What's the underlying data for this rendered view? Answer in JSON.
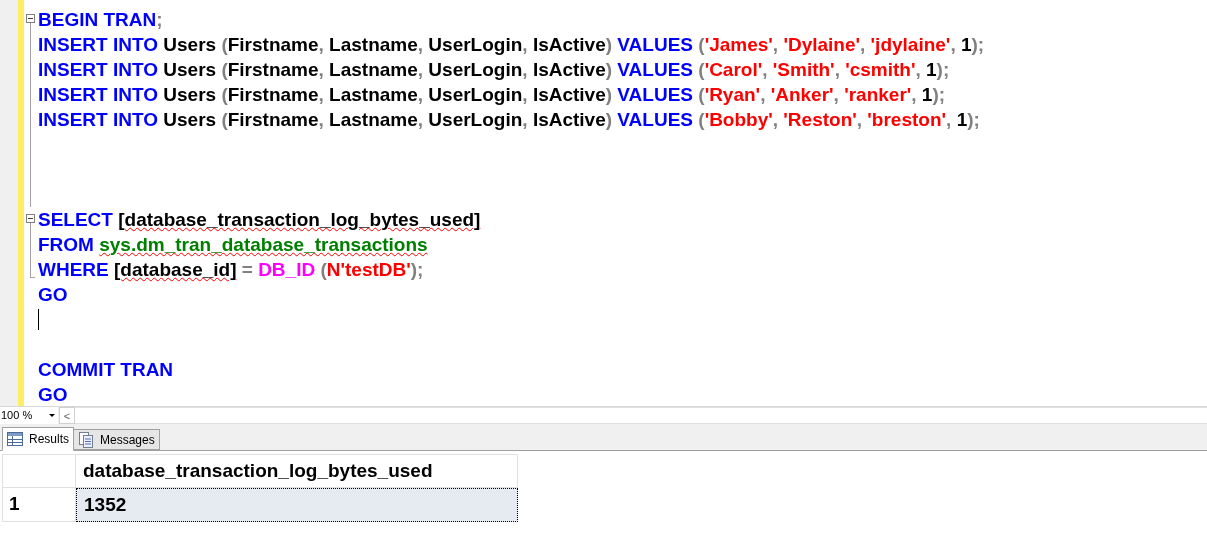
{
  "editor": {
    "lines": [
      {
        "kind": "fold_start",
        "tokens": [
          {
            "text": "BEGIN TRAN",
            "kind": "keyword"
          },
          {
            "text": ";",
            "kind": "punct"
          }
        ]
      },
      {
        "kind": "fold_body",
        "tokens": [
          {
            "text": "INSERT INTO ",
            "kind": "keyword"
          },
          {
            "text": "Users ",
            "kind": "ident"
          },
          {
            "text": "(",
            "kind": "punct"
          },
          {
            "text": "Firstname",
            "kind": "ident"
          },
          {
            "text": ", ",
            "kind": "punct"
          },
          {
            "text": "Lastname",
            "kind": "ident"
          },
          {
            "text": ", ",
            "kind": "punct"
          },
          {
            "text": "UserLogin",
            "kind": "ident"
          },
          {
            "text": ", ",
            "kind": "punct"
          },
          {
            "text": "IsActive",
            "kind": "ident"
          },
          {
            "text": ") ",
            "kind": "punct"
          },
          {
            "text": "VALUES ",
            "kind": "keyword"
          },
          {
            "text": "(",
            "kind": "punct"
          },
          {
            "text": "'James'",
            "kind": "string"
          },
          {
            "text": ", ",
            "kind": "punct"
          },
          {
            "text": "'Dylaine'",
            "kind": "string"
          },
          {
            "text": ", ",
            "kind": "punct"
          },
          {
            "text": "'jdylaine'",
            "kind": "string"
          },
          {
            "text": ", ",
            "kind": "punct"
          },
          {
            "text": "1",
            "kind": "number"
          },
          {
            "text": ");",
            "kind": "punct"
          }
        ]
      },
      {
        "kind": "fold_body",
        "tokens": [
          {
            "text": "INSERT INTO ",
            "kind": "keyword"
          },
          {
            "text": "Users ",
            "kind": "ident"
          },
          {
            "text": "(",
            "kind": "punct"
          },
          {
            "text": "Firstname",
            "kind": "ident"
          },
          {
            "text": ", ",
            "kind": "punct"
          },
          {
            "text": "Lastname",
            "kind": "ident"
          },
          {
            "text": ", ",
            "kind": "punct"
          },
          {
            "text": "UserLogin",
            "kind": "ident"
          },
          {
            "text": ", ",
            "kind": "punct"
          },
          {
            "text": "IsActive",
            "kind": "ident"
          },
          {
            "text": ") ",
            "kind": "punct"
          },
          {
            "text": "VALUES ",
            "kind": "keyword"
          },
          {
            "text": "(",
            "kind": "punct"
          },
          {
            "text": "'Carol'",
            "kind": "string"
          },
          {
            "text": ", ",
            "kind": "punct"
          },
          {
            "text": "'Smith'",
            "kind": "string"
          },
          {
            "text": ", ",
            "kind": "punct"
          },
          {
            "text": "'csmith'",
            "kind": "string"
          },
          {
            "text": ", ",
            "kind": "punct"
          },
          {
            "text": "1",
            "kind": "number"
          },
          {
            "text": ");",
            "kind": "punct"
          }
        ]
      },
      {
        "kind": "fold_body",
        "tokens": [
          {
            "text": "INSERT INTO ",
            "kind": "keyword"
          },
          {
            "text": "Users ",
            "kind": "ident"
          },
          {
            "text": "(",
            "kind": "punct"
          },
          {
            "text": "Firstname",
            "kind": "ident"
          },
          {
            "text": ", ",
            "kind": "punct"
          },
          {
            "text": "Lastname",
            "kind": "ident"
          },
          {
            "text": ", ",
            "kind": "punct"
          },
          {
            "text": "UserLogin",
            "kind": "ident"
          },
          {
            "text": ", ",
            "kind": "punct"
          },
          {
            "text": "IsActive",
            "kind": "ident"
          },
          {
            "text": ") ",
            "kind": "punct"
          },
          {
            "text": "VALUES ",
            "kind": "keyword"
          },
          {
            "text": "(",
            "kind": "punct"
          },
          {
            "text": "'Ryan'",
            "kind": "string"
          },
          {
            "text": ", ",
            "kind": "punct"
          },
          {
            "text": "'Anker'",
            "kind": "string"
          },
          {
            "text": ", ",
            "kind": "punct"
          },
          {
            "text": "'ranker'",
            "kind": "string"
          },
          {
            "text": ", ",
            "kind": "punct"
          },
          {
            "text": "1",
            "kind": "number"
          },
          {
            "text": ");",
            "kind": "punct"
          }
        ]
      },
      {
        "kind": "fold_body",
        "tokens": [
          {
            "text": "INSERT INTO ",
            "kind": "keyword"
          },
          {
            "text": "Users ",
            "kind": "ident"
          },
          {
            "text": "(",
            "kind": "punct"
          },
          {
            "text": "Firstname",
            "kind": "ident"
          },
          {
            "text": ", ",
            "kind": "punct"
          },
          {
            "text": "Lastname",
            "kind": "ident"
          },
          {
            "text": ", ",
            "kind": "punct"
          },
          {
            "text": "UserLogin",
            "kind": "ident"
          },
          {
            "text": ", ",
            "kind": "punct"
          },
          {
            "text": "IsActive",
            "kind": "ident"
          },
          {
            "text": ") ",
            "kind": "punct"
          },
          {
            "text": "VALUES ",
            "kind": "keyword"
          },
          {
            "text": "(",
            "kind": "punct"
          },
          {
            "text": "'Bobby'",
            "kind": "string"
          },
          {
            "text": ", ",
            "kind": "punct"
          },
          {
            "text": "'Reston'",
            "kind": "string"
          },
          {
            "text": ", ",
            "kind": "punct"
          },
          {
            "text": "'breston'",
            "kind": "string"
          },
          {
            "text": ", ",
            "kind": "punct"
          },
          {
            "text": "1",
            "kind": "number"
          },
          {
            "text": ");",
            "kind": "punct"
          }
        ]
      },
      {
        "kind": "fold_body"
      },
      {
        "kind": "fold_body"
      },
      {
        "kind": "fold_body"
      },
      {
        "kind": "fold_start",
        "tokens": [
          {
            "text": "SELECT ",
            "kind": "keyword"
          },
          {
            "text": "[database_transaction_log_bytes_used]",
            "kind": "flagged_ident"
          }
        ]
      },
      {
        "kind": "fold_body",
        "tokens": [
          {
            "text": "FROM ",
            "kind": "keyword"
          },
          {
            "text": "sys.dm_tran_database_transactions",
            "kind": "flagged_sysobj"
          }
        ]
      },
      {
        "kind": "fold_end",
        "tokens": [
          {
            "text": "WHERE ",
            "kind": "keyword"
          },
          {
            "text": "[database_id]",
            "kind": "flagged_ident"
          },
          {
            "text": " = ",
            "kind": "punct"
          },
          {
            "text": "DB_ID ",
            "kind": "func"
          },
          {
            "text": "(",
            "kind": "punct"
          },
          {
            "text": "N'testDB'",
            "kind": "string"
          },
          {
            "text": ");",
            "kind": "punct"
          }
        ]
      },
      {
        "kind": "plain",
        "tokens": [
          {
            "text": "GO",
            "kind": "keyword"
          }
        ]
      },
      {
        "kind": "caret"
      },
      {
        "kind": "plain"
      },
      {
        "kind": "plain",
        "tokens": [
          {
            "text": "COMMIT TRAN",
            "kind": "keyword"
          }
        ]
      },
      {
        "kind": "plain",
        "tokens": [
          {
            "text": "GO",
            "kind": "keyword"
          }
        ]
      }
    ]
  },
  "zoom": {
    "value": "100 %",
    "scroll_left": "<"
  },
  "tabs": [
    {
      "label": "Results",
      "selected": true,
      "kind": "grid"
    },
    {
      "label": "Messages",
      "selected": false,
      "kind": "messages"
    }
  ],
  "results": {
    "columns": [
      "database_transaction_log_bytes_used"
    ],
    "rows": [
      {
        "number": "1",
        "selected": true,
        "cells": [
          "1352"
        ]
      }
    ]
  }
}
